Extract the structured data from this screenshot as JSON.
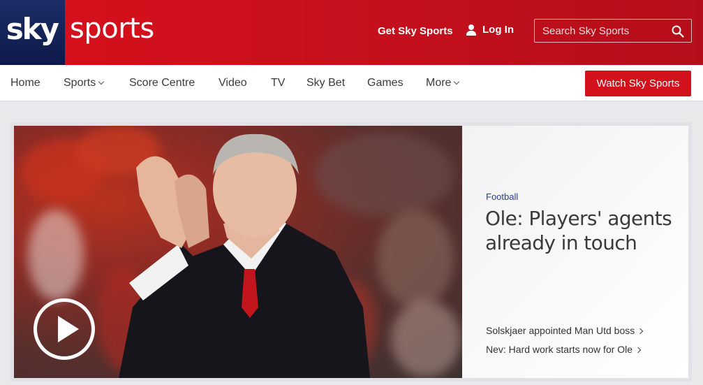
{
  "header": {
    "logo_sky": "sky",
    "logo_sports": "sports",
    "get_sky_sports": "Get Sky Sports",
    "login": "Log In",
    "search_placeholder": "Search Sky Sports"
  },
  "nav": {
    "items": [
      {
        "label": "Home"
      },
      {
        "label": "Sports",
        "dropdown": true
      },
      {
        "label": "Score Centre"
      },
      {
        "label": "Video"
      },
      {
        "label": "TV"
      },
      {
        "label": "Sky Bet"
      },
      {
        "label": "Games"
      },
      {
        "label": "More",
        "dropdown": true
      }
    ],
    "watch_button": "Watch Sky Sports"
  },
  "hero": {
    "category": "Football",
    "headline": "Ole: Players' agents already in touch",
    "related": [
      {
        "label": "Solskjaer appointed Man Utd boss"
      },
      {
        "label": "Nev: Hard work starts now for Ole"
      }
    ],
    "image_alt": "Ole Gunnar Solskjaer applauding",
    "play_icon": "play-icon"
  },
  "colors": {
    "brand_red": "#d3111d",
    "sky_blue": "#0d1a4a",
    "category_blue": "#2b3d8f"
  }
}
